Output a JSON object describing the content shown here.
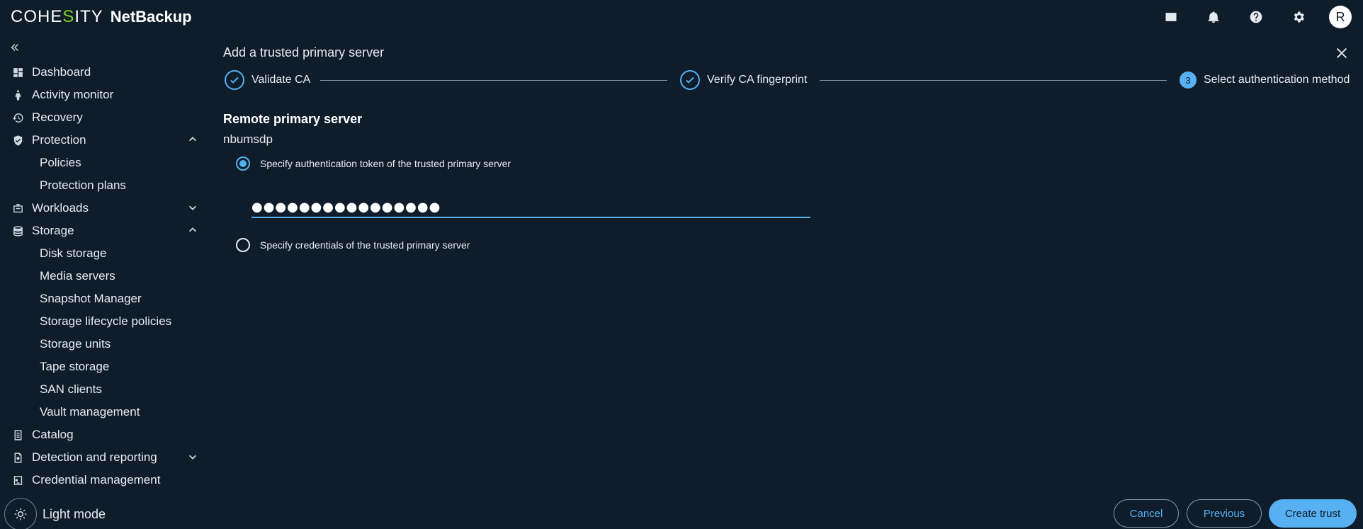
{
  "header": {
    "brand_pre": "COHE",
    "brand_s": "S",
    "brand_post": "ITY",
    "product": "NetBackup",
    "icons": [
      "vault-icon",
      "bell-icon",
      "help-icon",
      "gear-icon"
    ],
    "avatar_initial": "R"
  },
  "sidebar": {
    "items": [
      {
        "label": "Dashboard",
        "icon": "dashboard-icon"
      },
      {
        "label": "Activity monitor",
        "icon": "activity-icon"
      },
      {
        "label": "Recovery",
        "icon": "recovery-icon"
      },
      {
        "label": "Protection",
        "icon": "shield-icon",
        "expanded": true
      },
      {
        "label": "Policies"
      },
      {
        "label": "Protection plans"
      },
      {
        "label": "Workloads",
        "icon": "workloads-icon",
        "expanded": false
      },
      {
        "label": "Storage",
        "icon": "storage-icon",
        "expanded": true
      },
      {
        "label": "Disk storage"
      },
      {
        "label": "Media servers"
      },
      {
        "label": "Snapshot Manager"
      },
      {
        "label": "Storage lifecycle policies"
      },
      {
        "label": "Storage units"
      },
      {
        "label": "Tape storage"
      },
      {
        "label": "SAN clients"
      },
      {
        "label": "Vault management"
      },
      {
        "label": "Catalog",
        "icon": "catalog-icon"
      },
      {
        "label": "Detection and reporting",
        "icon": "detection-icon",
        "expanded": false
      },
      {
        "label": "Credential management",
        "icon": "credential-icon"
      }
    ],
    "light_mode_label": "Light mode"
  },
  "dialog": {
    "title": "Add a trusted primary server",
    "steps": [
      {
        "label": "Validate CA",
        "state": "done"
      },
      {
        "label": "Verify CA fingerprint",
        "state": "done"
      },
      {
        "label": "Select authentication method",
        "state": "current",
        "number": "3"
      }
    ],
    "section_heading": "Remote primary server",
    "server_name": "nbumsdp",
    "options": [
      {
        "label": "Specify authentication token of the trusted primary server",
        "selected": true
      },
      {
        "label": "Specify credentials of the trusted primary server",
        "selected": false
      }
    ],
    "token_value": "●●●●●●●●●●●●●●●●"
  },
  "footer": {
    "cancel_label": "Cancel",
    "previous_label": "Previous",
    "create_label": "Create trust"
  },
  "colors": {
    "background": "#0f1d2b",
    "accent": "#56b0f2",
    "brand_green": "#7ed321"
  }
}
